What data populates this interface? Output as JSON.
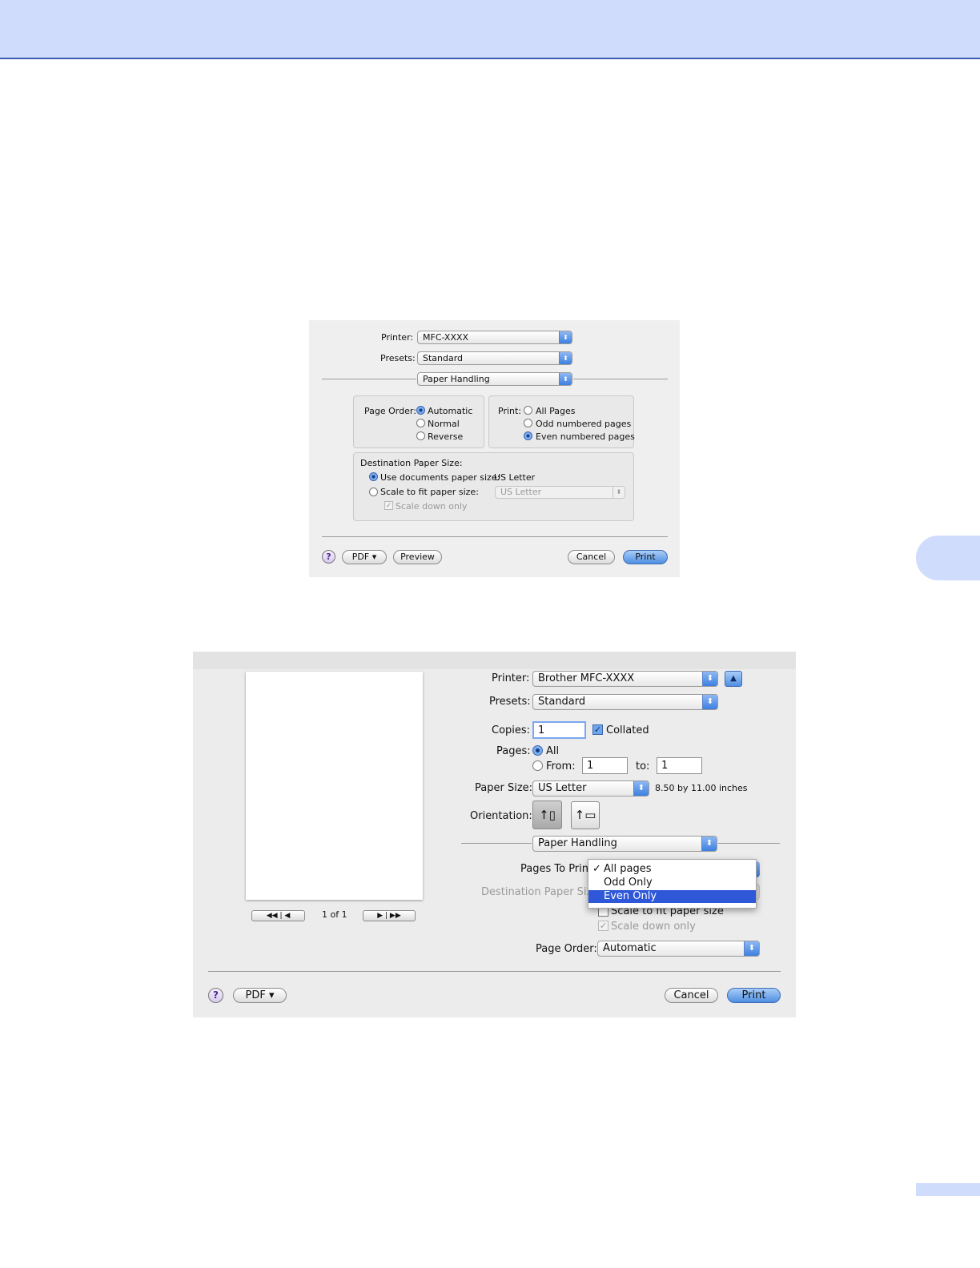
{
  "shot1": {
    "printer": {
      "label": "Printer:",
      "value": "MFC-XXXX"
    },
    "presets": {
      "label": "Presets:",
      "value": "Standard"
    },
    "section": "Paper Handling",
    "page_order": {
      "label": "Page Order:",
      "options": [
        "Automatic",
        "Normal",
        "Reverse"
      ],
      "selected": "Automatic"
    },
    "print": {
      "label": "Print:",
      "options": [
        "All Pages",
        "Odd numbered pages",
        "Even numbered pages"
      ],
      "selected": "Even numbered pages"
    },
    "destination": {
      "title": "Destination Paper Size:",
      "use_docs_label": "Use documents paper size:",
      "use_docs_value": "US Letter",
      "scale_label": "Scale to fit paper size:",
      "scale_value": "US Letter",
      "scale_down_label": "Scale down only"
    },
    "buttons": {
      "help": "?",
      "pdf": "PDF ▾",
      "preview": "Preview",
      "cancel": "Cancel",
      "print": "Print"
    }
  },
  "shot2": {
    "printer": {
      "label": "Printer:",
      "value": "Brother MFC-XXXX"
    },
    "presets": {
      "label": "Presets:",
      "value": "Standard"
    },
    "copies": {
      "label": "Copies:",
      "value": "1",
      "collated_label": "Collated",
      "collated": true
    },
    "pages": {
      "label": "Pages:",
      "all_label": "All",
      "from_label": "From:",
      "from_value": "1",
      "to_label": "to:",
      "to_value": "1"
    },
    "paper_size": {
      "label": "Paper Size:",
      "value": "US Letter",
      "dimensions": "8.50 by 11.00 inches"
    },
    "orientation": {
      "label": "Orientation:"
    },
    "section": "Paper Handling",
    "pages_to_print": {
      "label": "Pages To Print",
      "options": [
        "All pages",
        "Odd Only",
        "Even Only"
      ],
      "checked": "All pages",
      "highlighted": "Even Only"
    },
    "destination": {
      "label": "Destination Paper Size",
      "scale_label": "Scale to fit paper size",
      "scale_down_label": "Scale down only"
    },
    "page_order": {
      "label": "Page Order:",
      "value": "Automatic"
    },
    "preview": {
      "page_counter": "1 of 1"
    },
    "buttons": {
      "help": "?",
      "pdf": "PDF ▾",
      "cancel": "Cancel",
      "print": "Print"
    }
  }
}
